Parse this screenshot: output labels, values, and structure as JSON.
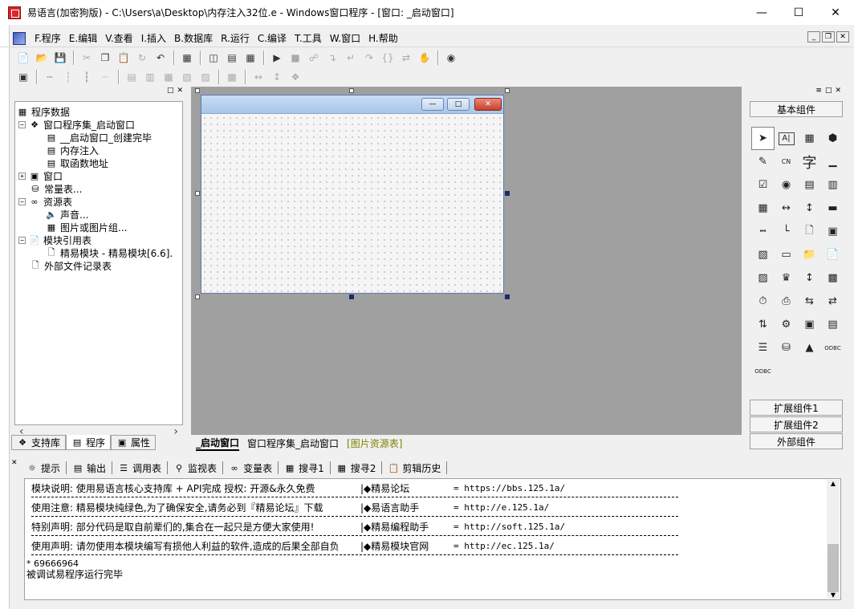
{
  "window": {
    "title": "易语言(加密狗版) - C:\\Users\\a\\Desktop\\内存注入32位.e - Windows窗口程序 - [窗口: _启动窗口]"
  },
  "menu": [
    "F.程序",
    "E.编辑",
    "V.查看",
    "I.插入",
    "B.数据库",
    "R.运行",
    "C.编译",
    "T.工具",
    "W.窗口",
    "H.帮助"
  ],
  "tree": {
    "root": "程序数据",
    "window_set": "窗口程序集_启动窗口",
    "sub1": "__启动窗口_创建完毕",
    "sub2": "内存注入",
    "sub3": "取函数地址",
    "window": "窗口",
    "constants": "常量表...",
    "resources": "资源表",
    "sound": "声音...",
    "images": "图片或图片组...",
    "modules": "模块引用表",
    "module1": "精易模块 - 精易模块[6.6].",
    "external": "外部文件记录表"
  },
  "left_tabs": {
    "support": "支持库",
    "program": "程序",
    "property": "属性"
  },
  "design_tabs": {
    "start": "_启动窗口",
    "set": "窗口程序集_启动窗口",
    "img": "[图片资源表]"
  },
  "right_panel": {
    "basic": "基本组件",
    "ext1": "扩展组件1",
    "ext2": "扩展组件2",
    "external": "外部组件"
  },
  "palette_labels": {
    "label": "A|",
    "cn": "CN",
    "char": "字",
    "odbc": "ODBC"
  },
  "bottom_tabs": {
    "hint": "提示",
    "output": "输出",
    "calls": "调用表",
    "watch": "监视表",
    "vars": "变量表",
    "find1": "搜寻1",
    "find2": "搜寻2",
    "clip": "剪辑历史"
  },
  "output": {
    "r1_left": "模块说明: 使用易语言核心支持库 + API完成      授权: 开源&永久免费",
    "r1_mid": "|◆精易论坛",
    "r1_url": "=  https://bbs.125.1a/",
    "r2_left": "使用注意: 精易模块纯绿色,为了确保安全,请务必到『精易论坛』下载",
    "r2_mid": "|◆易语言助手",
    "r2_url": "=  http://e.125.1a/",
    "r3_left": "特别声明: 部分代码是取自前辈们的,集合在一起只是方便大家使用!",
    "r3_mid": "|◆精易编程助手",
    "r3_url": "=  http://soft.125.1a/",
    "r4_left": "使用声明: 请勿使用本模块编写有损他人利益的软件,造成的后果全部自负",
    "r4_mid": "|◆精易模块官网",
    "r4_url": "=  http://ec.125.1a/",
    "line5": "* 69666964",
    "line6": "被调试易程序运行完毕"
  }
}
